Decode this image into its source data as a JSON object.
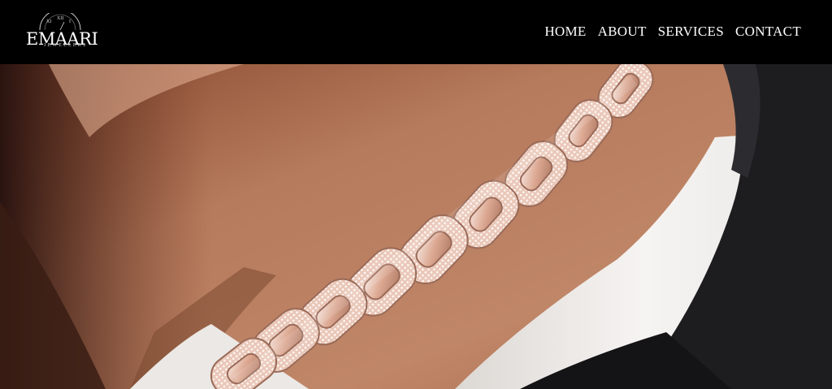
{
  "brand": {
    "name": "EMAARI",
    "subtitle": "JEWELLERS"
  },
  "nav": {
    "items": [
      {
        "label": "HOME"
      },
      {
        "label": "ABOUT"
      },
      {
        "label": "SERVICES"
      },
      {
        "label": "CONTACT"
      }
    ]
  },
  "hero": {
    "image": "close-up-iced-cuban-link-chain-on-neck"
  },
  "colors": {
    "header_bg": "#000000",
    "nav_text": "#ffffff",
    "chain_rose_gold": "#d9a48a",
    "skin": "#b87a5a",
    "shirt": "#f4f2f0",
    "jacket": "#1c1c1e"
  }
}
